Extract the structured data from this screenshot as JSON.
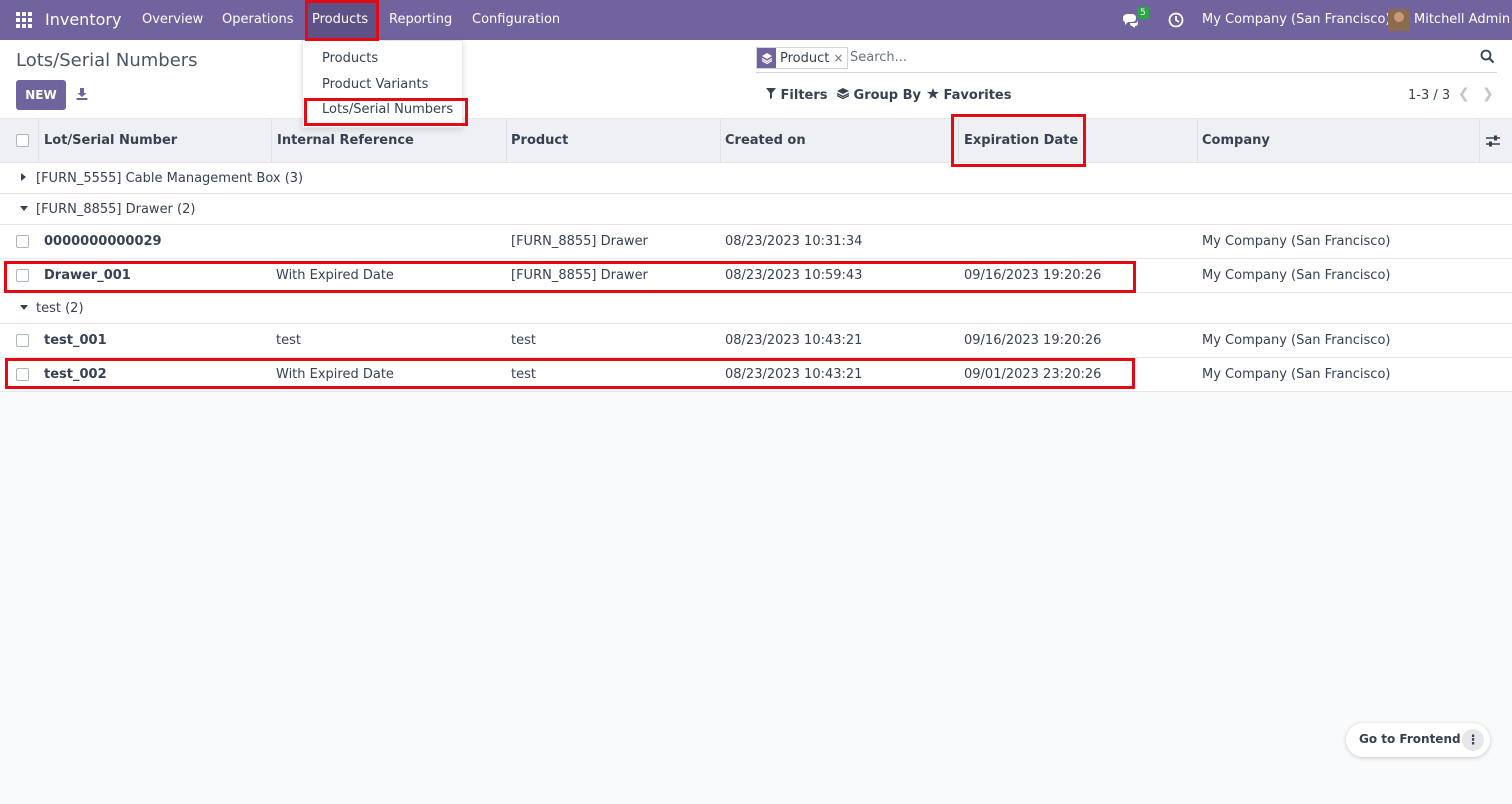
{
  "navbar": {
    "brand": "Inventory",
    "menu": [
      "Overview",
      "Operations",
      "Products",
      "Reporting",
      "Configuration"
    ],
    "messages_count": "5",
    "company": "My Company (San Francisco)",
    "user": "Mitchell Admin"
  },
  "dropdown": {
    "items": [
      "Products",
      "Product Variants",
      "Lots/Serial Numbers"
    ]
  },
  "control": {
    "title": "Lots/Serial Numbers",
    "new_label": "NEW",
    "facet_label": "Product",
    "facet_remove": "×",
    "search_placeholder": "Search...",
    "filters": "Filters",
    "group_by": "Group By",
    "favorites": "Favorites",
    "pager": "1-3 / 3"
  },
  "table": {
    "headers": [
      "Lot/Serial Number",
      "Internal Reference",
      "Product",
      "Created on",
      "Expiration Date",
      "Company"
    ],
    "groups": [
      {
        "label": "[FURN_5555] Cable Management Box (3)"
      },
      {
        "label": "[FURN_8855] Drawer (2)"
      },
      {
        "label": "test (2)"
      }
    ],
    "rows": [
      {
        "lot": "0000000000029",
        "ref": "",
        "product": "[FURN_8855] Drawer",
        "created": "08/23/2023 10:31:34",
        "expiration": "",
        "company": "My Company (San Francisco)"
      },
      {
        "lot": "Drawer_001",
        "ref": "With Expired Date",
        "product": "[FURN_8855] Drawer",
        "created": "08/23/2023 10:59:43",
        "expiration": "09/16/2023 19:20:26",
        "company": "My Company (San Francisco)"
      },
      {
        "lot": "test_001",
        "ref": "test",
        "product": "test",
        "created": "08/23/2023 10:43:21",
        "expiration": "09/16/2023 19:20:26",
        "company": "My Company (San Francisco)"
      },
      {
        "lot": "test_002",
        "ref": "With Expired Date",
        "product": "test",
        "created": "08/23/2023 10:43:21",
        "expiration": "09/01/2023 23:20:26",
        "company": "My Company (San Francisco)"
      }
    ]
  },
  "floating": {
    "go_to_frontend": "Go to Frontend",
    "more": "⋮"
  },
  "colors": {
    "brand": "#71639e",
    "highlight": "#e50914",
    "badge": "#28a745"
  }
}
